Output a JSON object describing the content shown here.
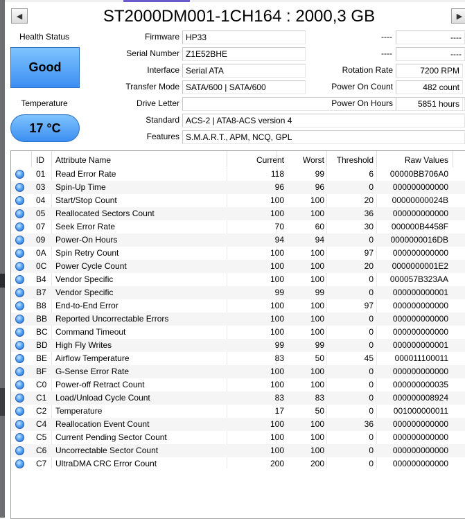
{
  "title": "ST2000DM001-1CH164 : 2000,3 GB",
  "nav": {
    "prev": "◀",
    "next": "▶"
  },
  "health": {
    "label": "Health Status",
    "value": "Good"
  },
  "temperature": {
    "label": "Temperature",
    "value": "17 °C"
  },
  "info": {
    "firmware": {
      "label": "Firmware",
      "value": "HP33"
    },
    "serial": {
      "label": "Serial Number",
      "value": "Z1E52BHE"
    },
    "interface": {
      "label": "Interface",
      "value": "Serial ATA"
    },
    "transfer_mode": {
      "label": "Transfer Mode",
      "value": "SATA/600 | SATA/600"
    },
    "drive_letter": {
      "label": "Drive Letter",
      "value": ""
    },
    "standard": {
      "label": "Standard",
      "value": "ACS-2 | ATA8-ACS version 4"
    },
    "features": {
      "label": "Features",
      "value": "S.M.A.R.T., APM, NCQ, GPL"
    }
  },
  "right_info": {
    "blank1": {
      "label": "----",
      "value": "----"
    },
    "blank2": {
      "label": "----",
      "value": "----"
    },
    "rotation": {
      "label": "Rotation Rate",
      "value": "7200 RPM"
    },
    "power_count": {
      "label": "Power On Count",
      "value": "482 count"
    },
    "power_hours": {
      "label": "Power On Hours",
      "value": "5851 hours"
    }
  },
  "table": {
    "headers": {
      "id": "ID",
      "name": "Attribute Name",
      "current": "Current",
      "worst": "Worst",
      "threshold": "Threshold",
      "raw": "Raw Values"
    },
    "rows": [
      {
        "id": "01",
        "name": "Read Error Rate",
        "current": "118",
        "worst": "99",
        "threshold": "6",
        "raw": "00000BB706A0"
      },
      {
        "id": "03",
        "name": "Spin-Up Time",
        "current": "96",
        "worst": "96",
        "threshold": "0",
        "raw": "000000000000"
      },
      {
        "id": "04",
        "name": "Start/Stop Count",
        "current": "100",
        "worst": "100",
        "threshold": "20",
        "raw": "00000000024B"
      },
      {
        "id": "05",
        "name": "Reallocated Sectors Count",
        "current": "100",
        "worst": "100",
        "threshold": "36",
        "raw": "000000000000"
      },
      {
        "id": "07",
        "name": "Seek Error Rate",
        "current": "70",
        "worst": "60",
        "threshold": "30",
        "raw": "000000B4458F"
      },
      {
        "id": "09",
        "name": "Power-On Hours",
        "current": "94",
        "worst": "94",
        "threshold": "0",
        "raw": "0000000016DB"
      },
      {
        "id": "0A",
        "name": "Spin Retry Count",
        "current": "100",
        "worst": "100",
        "threshold": "97",
        "raw": "000000000000"
      },
      {
        "id": "0C",
        "name": "Power Cycle Count",
        "current": "100",
        "worst": "100",
        "threshold": "20",
        "raw": "0000000001E2"
      },
      {
        "id": "B4",
        "name": "Vendor Specific",
        "current": "100",
        "worst": "100",
        "threshold": "0",
        "raw": "000057B323AA"
      },
      {
        "id": "B7",
        "name": "Vendor Specific",
        "current": "99",
        "worst": "99",
        "threshold": "0",
        "raw": "000000000001"
      },
      {
        "id": "B8",
        "name": "End-to-End Error",
        "current": "100",
        "worst": "100",
        "threshold": "97",
        "raw": "000000000000"
      },
      {
        "id": "BB",
        "name": "Reported Uncorrectable Errors",
        "current": "100",
        "worst": "100",
        "threshold": "0",
        "raw": "000000000000"
      },
      {
        "id": "BC",
        "name": "Command Timeout",
        "current": "100",
        "worst": "100",
        "threshold": "0",
        "raw": "000000000000"
      },
      {
        "id": "BD",
        "name": "High Fly Writes",
        "current": "99",
        "worst": "99",
        "threshold": "0",
        "raw": "000000000001"
      },
      {
        "id": "BE",
        "name": "Airflow Temperature",
        "current": "83",
        "worst": "50",
        "threshold": "45",
        "raw": "000011100011"
      },
      {
        "id": "BF",
        "name": "G-Sense Error Rate",
        "current": "100",
        "worst": "100",
        "threshold": "0",
        "raw": "000000000000"
      },
      {
        "id": "C0",
        "name": "Power-off Retract Count",
        "current": "100",
        "worst": "100",
        "threshold": "0",
        "raw": "000000000035"
      },
      {
        "id": "C1",
        "name": "Load/Unload Cycle Count",
        "current": "83",
        "worst": "83",
        "threshold": "0",
        "raw": "000000008924"
      },
      {
        "id": "C2",
        "name": "Temperature",
        "current": "17",
        "worst": "50",
        "threshold": "0",
        "raw": "001000000011"
      },
      {
        "id": "C4",
        "name": "Reallocation Event Count",
        "current": "100",
        "worst": "100",
        "threshold": "36",
        "raw": "000000000000"
      },
      {
        "id": "C5",
        "name": "Current Pending Sector Count",
        "current": "100",
        "worst": "100",
        "threshold": "0",
        "raw": "000000000000"
      },
      {
        "id": "C6",
        "name": "Uncorrectable Sector Count",
        "current": "100",
        "worst": "100",
        "threshold": "0",
        "raw": "000000000000"
      },
      {
        "id": "C7",
        "name": "UltraDMA CRC Error Count",
        "current": "200",
        "worst": "200",
        "threshold": "0",
        "raw": "000000000000"
      }
    ]
  }
}
